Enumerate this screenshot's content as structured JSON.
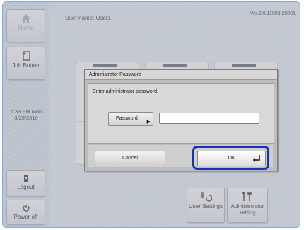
{
  "header": {
    "username": "User name: User1",
    "version": "Ver.2.0.11003.25001"
  },
  "sidebar": {
    "home_label": "Home",
    "job_label": "Job Button",
    "clock_time": "1:33 PM  Mon",
    "clock_date": "3/29/2010",
    "logout_label": "Logout",
    "power_label": "Power off"
  },
  "main": {
    "user_settings_label": "User Settings",
    "admin_setting_line1": "Administrator",
    "admin_setting_line2": "setting"
  },
  "dialog": {
    "title": "Administrator Password",
    "message": "Enter administrator password.",
    "password_button": "Password",
    "password_value": "",
    "cancel": "Cancel",
    "ok": "OK",
    "highlight_color": "#1632b6"
  },
  "icons": [
    "home-icon",
    "job-button-icon",
    "logout-icon",
    "power-icon",
    "user-settings-icon",
    "admin-setting-icon",
    "enter-icon",
    "arrow-right-icon"
  ]
}
